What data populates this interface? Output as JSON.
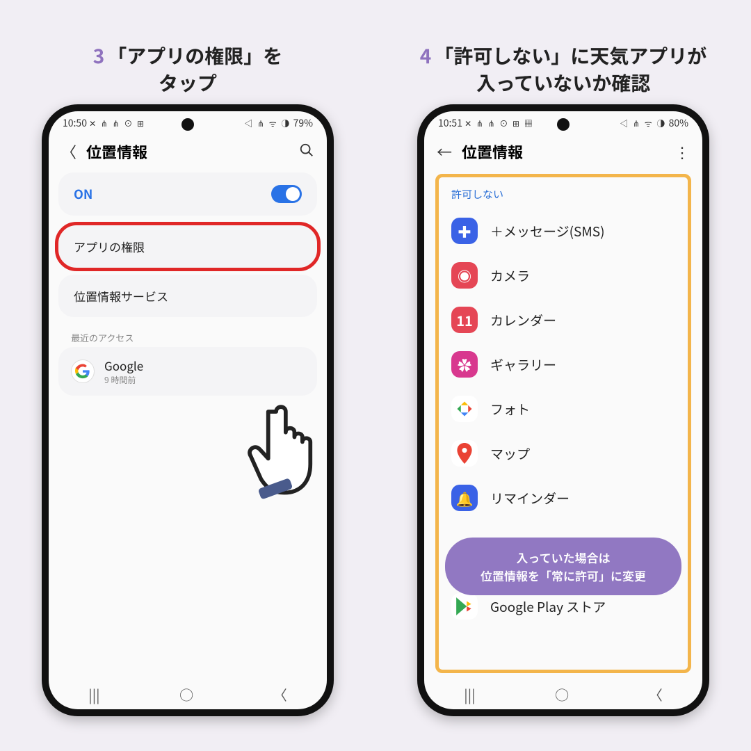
{
  "step3": {
    "num": "3",
    "caption_a": "「アプリの権限」を",
    "caption_b": "タップ",
    "statusbar": {
      "time": "10:50",
      "leftico": "✕ ⋔ ⋔ ⊙ ⊞",
      "rightico": "◁ ⋔ ᯤ ◑",
      "battery": "79%"
    },
    "hdr": {
      "title": "位置情報"
    },
    "on_label": "ON",
    "row_app_perm": "アプリの権限",
    "row_loc_service": "位置情報サービス",
    "recent_label": "最近のアクセス",
    "recent_app": "Google",
    "recent_time": "9 時間前"
  },
  "step4": {
    "num": "4",
    "caption_a": "「許可しない」に天気アプリが",
    "caption_b": "入っていないか確認",
    "statusbar": {
      "time": "10:51",
      "leftico": "✕ ⋔ ⋔ ⊙ ⊞ ▦",
      "rightico": "◁ ⋔ ᯤ ◑",
      "battery": "80%"
    },
    "hdr": {
      "title": "位置情報"
    },
    "deny_label": "許可しない",
    "apps": {
      "a0": "＋メッセージ(SMS)",
      "a1": "カメラ",
      "a2": "カレンダー",
      "a3": "ギャラリー",
      "a4": "フォト",
      "a5": "マップ",
      "a6": "リマインダー",
      "a7": "Google Play ストア"
    },
    "pill_a": "入っていた場合は",
    "pill_b": "位置情報を「常に許可」に変更"
  }
}
